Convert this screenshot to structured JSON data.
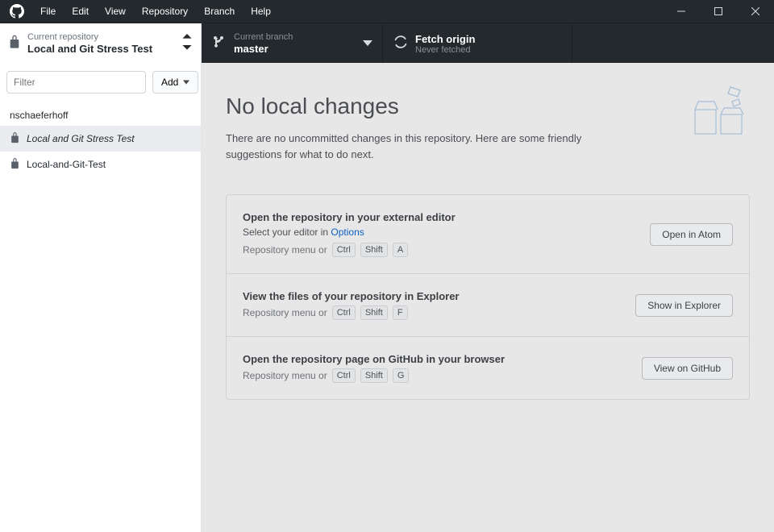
{
  "menu": {
    "file": "File",
    "edit": "Edit",
    "view": "View",
    "repository": "Repository",
    "branch": "Branch",
    "help": "Help"
  },
  "toolbar": {
    "repo_label": "Current repository",
    "repo_name": "Local and Git Stress Test",
    "branch_label": "Current branch",
    "branch_name": "master",
    "fetch_label": "Fetch origin",
    "fetch_status": "Never fetched"
  },
  "sidebar": {
    "filter_placeholder": "Filter",
    "add_label": "Add",
    "section_label": "nschaeferhoff",
    "repos": [
      {
        "name": "Local and Git Stress Test",
        "selected": true
      },
      {
        "name": "Local-and-Git-Test",
        "selected": false
      }
    ]
  },
  "main": {
    "title": "No local changes",
    "subtitle": "There are no uncommitted changes in this repository. Here are some friendly suggestions for what to do next.",
    "cards": [
      {
        "title": "Open the repository in your external editor",
        "sub_text": "Select your editor in ",
        "sub_link": "Options",
        "hint_text": "Repository menu or",
        "keys": [
          "Ctrl",
          "Shift",
          "A"
        ],
        "button": "Open in Atom"
      },
      {
        "title": "View the files of your repository in Explorer",
        "hint_text": "Repository menu or",
        "keys": [
          "Ctrl",
          "Shift",
          "F"
        ],
        "button": "Show in Explorer"
      },
      {
        "title": "Open the repository page on GitHub in your browser",
        "hint_text": "Repository menu or",
        "keys": [
          "Ctrl",
          "Shift",
          "G"
        ],
        "button": "View on GitHub"
      }
    ]
  }
}
